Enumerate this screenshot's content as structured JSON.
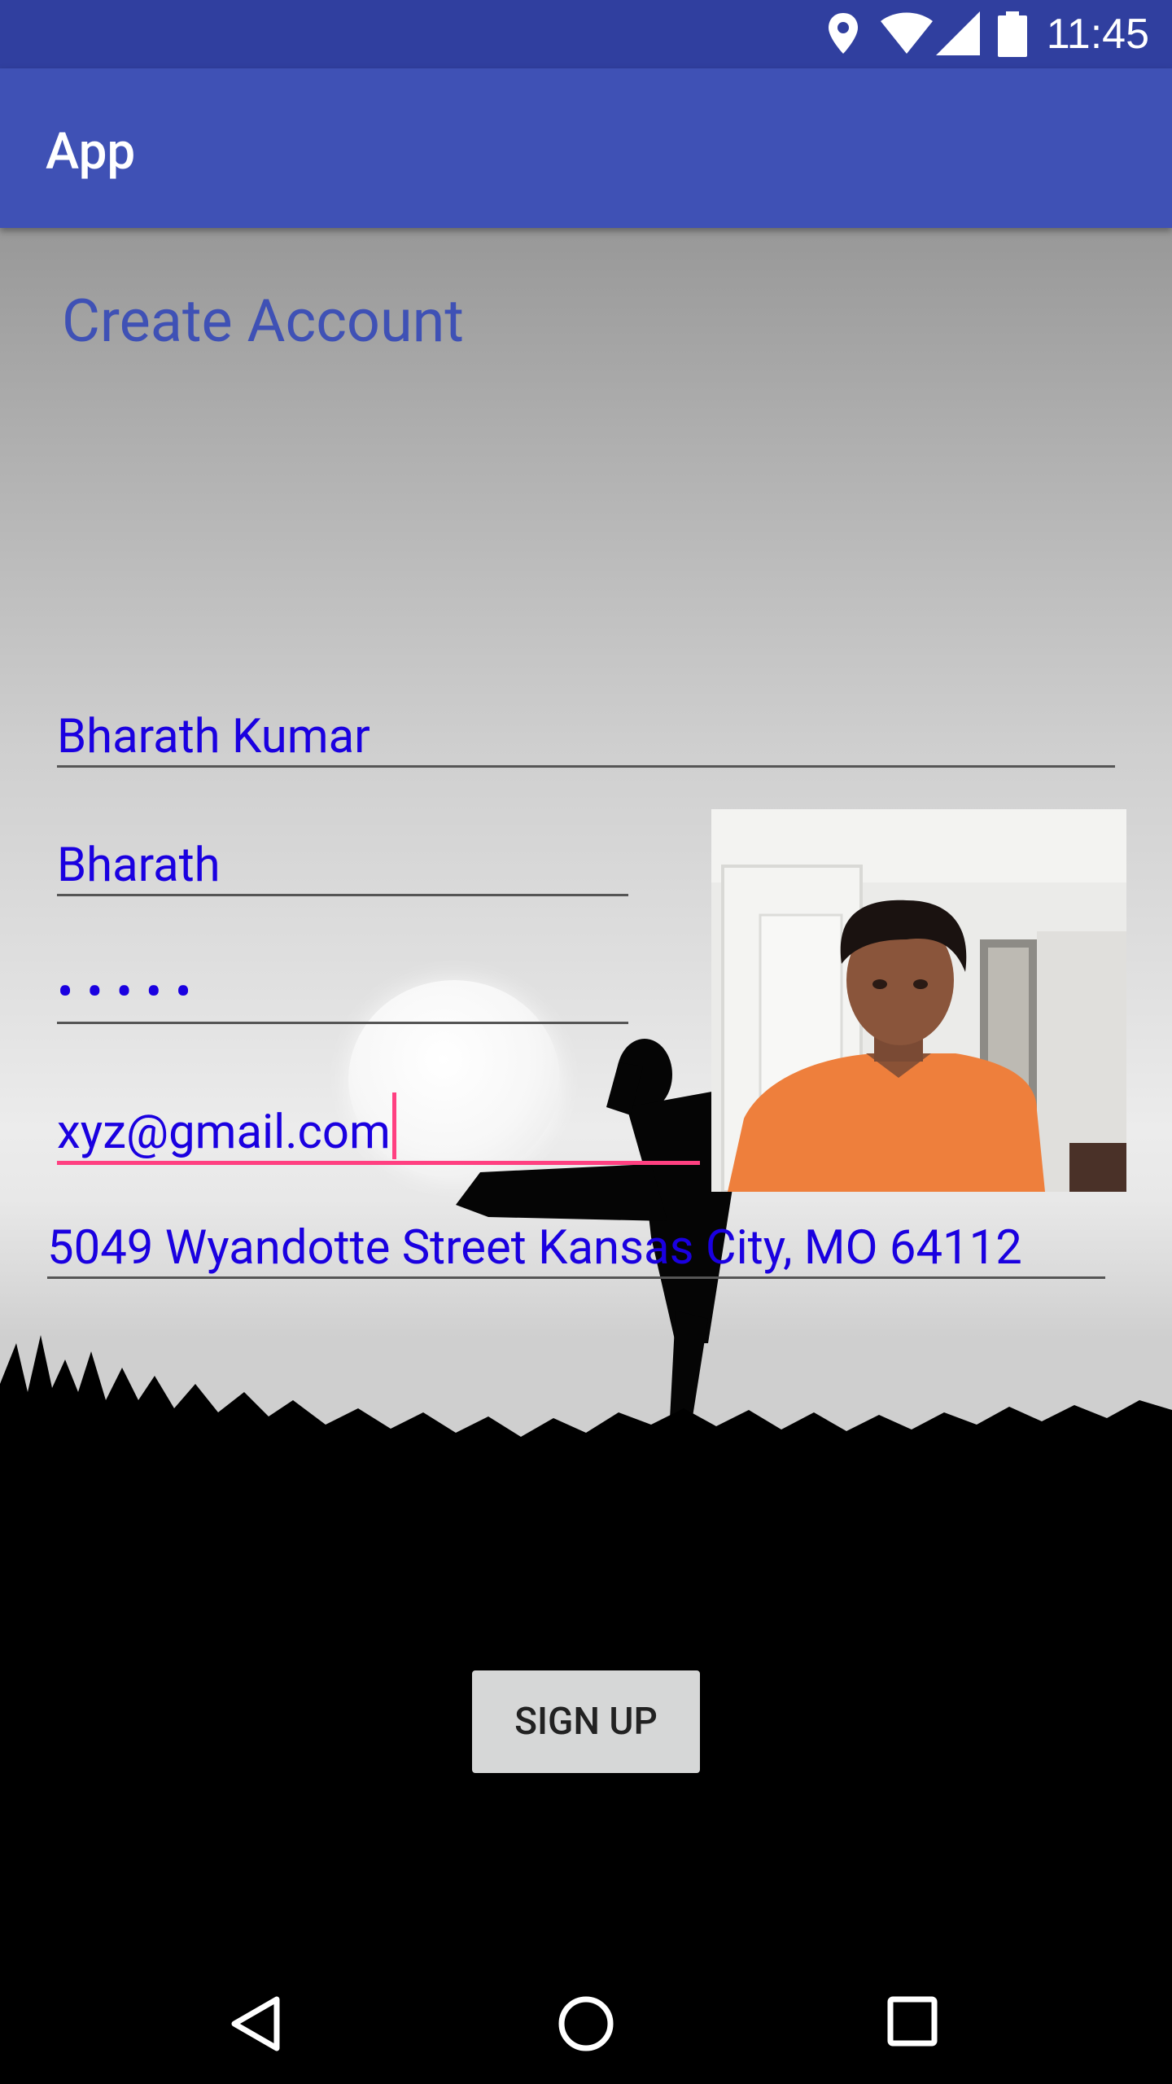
{
  "status_bar": {
    "time": "11:45",
    "icons": [
      "location-icon",
      "wifi-icon",
      "signal-icon",
      "battery-icon"
    ]
  },
  "app_bar": {
    "title": "App"
  },
  "form": {
    "heading": "Create Account",
    "full_name": "Bharath Kumar",
    "username": "Bharath",
    "password_mask": "•••••",
    "email": "xyz@gmail.com",
    "address": "5049 Wyandotte Street Kansas City, MO 64112",
    "signup_label": "SIGN UP"
  },
  "nav_bar": {
    "buttons": [
      "back-icon",
      "home-icon",
      "recents-icon"
    ]
  },
  "colors": {
    "status_bar": "#303F9F",
    "app_bar": "#3F51B5",
    "accent": "#FF4081",
    "field_text": "#1a00e0"
  }
}
